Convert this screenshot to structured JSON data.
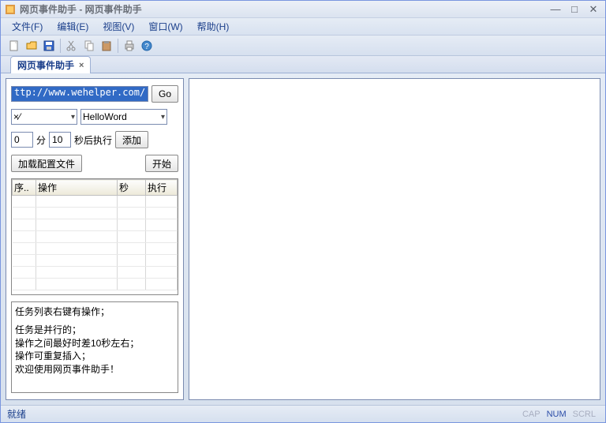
{
  "window": {
    "title": "网页事件助手 - 网页事件助手"
  },
  "menu": {
    "file": "文件(F)",
    "edit": "编辑(E)",
    "view": "视图(V)",
    "window": "窗口(W)",
    "help": "帮助(H)"
  },
  "tab": {
    "label": "网页事件助手",
    "close": "×"
  },
  "panel": {
    "url": "ttp://www.wehelper.com/",
    "go": "Go",
    "combo1": "×⁄",
    "combo2": "HelloWord",
    "min_val": "0",
    "min_label": "分",
    "sec_val": "10",
    "sec_label": "秒后执行",
    "add": "添加",
    "load_config": "加载配置文件",
    "start": "开始"
  },
  "table": {
    "headers": {
      "seq": "序..",
      "op": "操作",
      "sec": "秒",
      "exec": "执行"
    }
  },
  "info": {
    "line1": "任务列表右键有操作；",
    "line2": "任务是并行的；",
    "line3": "操作之间最好时差10秒左右；",
    "line4": "操作可重复插入；",
    "line5": "欢迎使用网页事件助手！"
  },
  "status": {
    "ready": "就绪",
    "cap": "CAP",
    "num": "NUM",
    "scrl": "SCRL"
  }
}
